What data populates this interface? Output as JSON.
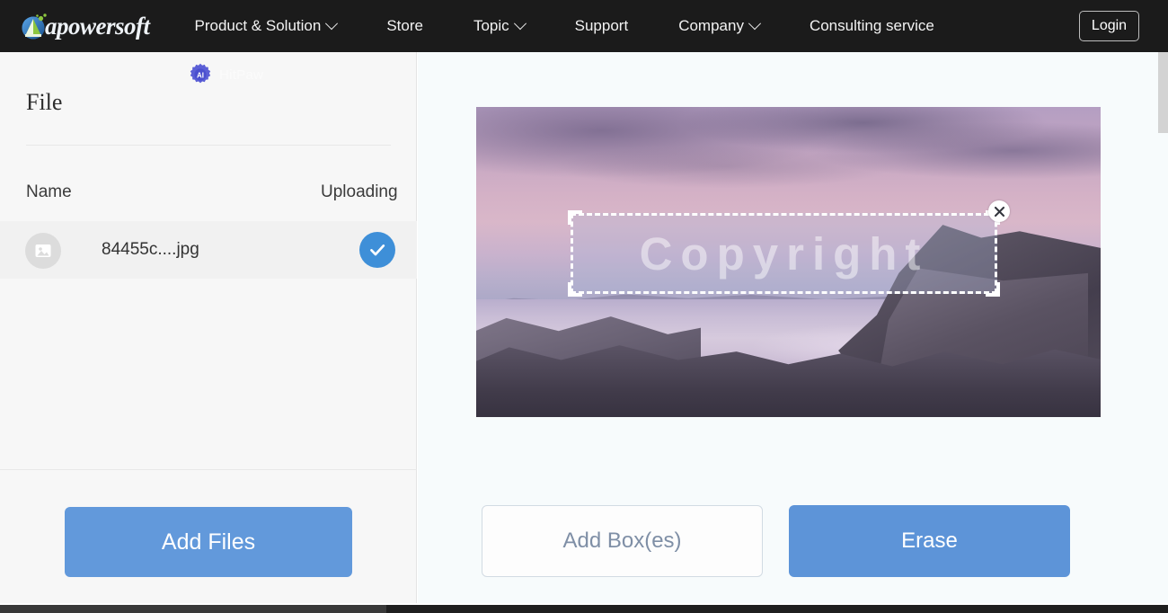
{
  "nav": {
    "logo_text": "apowersoft",
    "logo_icon": "apowersoft-logo-icon",
    "items": [
      {
        "label": "Product & Solution",
        "has_dropdown": true
      },
      {
        "label": "Store",
        "has_dropdown": false
      },
      {
        "label": "Topic",
        "has_dropdown": true
      },
      {
        "label": "Support",
        "has_dropdown": false
      },
      {
        "label": "Company",
        "has_dropdown": true
      },
      {
        "label": "Consulting service",
        "has_dropdown": false
      }
    ],
    "login_label": "Login",
    "background_color": "#1b1b1b"
  },
  "sidebar": {
    "ai_badge_text": "AI",
    "ai_badge_label": "HitPaw",
    "title": "File",
    "columns": {
      "name": "Name",
      "status": "Uploading"
    },
    "rows": [
      {
        "thumb_icon": "image-placeholder-icon",
        "filename": "84455c....jpg",
        "status_icon": "check-circle-icon",
        "status_color": "#3e8fd8"
      }
    ],
    "add_files_label": "Add Files",
    "add_files_color": "#6299db"
  },
  "editor": {
    "image_alt": "purple sunset coastal seascape with rocks",
    "selection": {
      "watermark_text": "Copyright",
      "close_icon": "close-x-icon"
    },
    "add_box_label": "Add Box(es)",
    "erase_label": "Erase",
    "erase_color": "#5d94d8",
    "add_box_text_color": "#7f8fa6"
  },
  "colors": {
    "accent_blue": "#5d94d8",
    "panel_left_bg": "#f7f7f7",
    "panel_right_bg": "#f7fbfc",
    "nav_bg": "#1b1b1b"
  }
}
